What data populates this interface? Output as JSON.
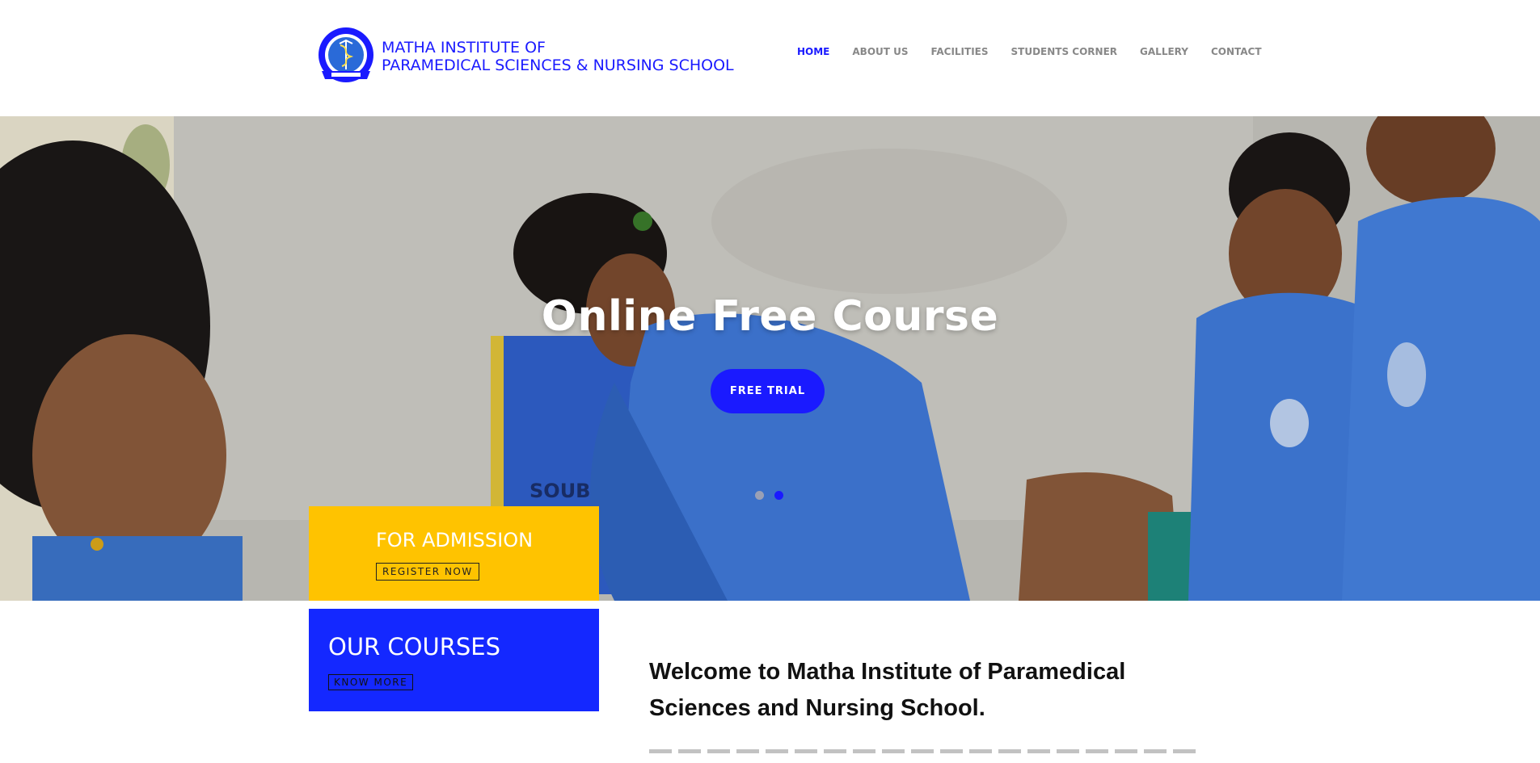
{
  "brand": {
    "line1": "MATHA INSTITUTE OF",
    "line2": "PARAMEDICAL SCIENCES & NURSING SCHOOL",
    "color": "#1a1aff"
  },
  "nav": {
    "items": [
      {
        "label": "HOME",
        "active": true
      },
      {
        "label": "ABOUT US",
        "active": false
      },
      {
        "label": "FACILITIES",
        "active": false
      },
      {
        "label": "STUDENTS CORNER",
        "active": false
      },
      {
        "label": "GALLERY",
        "active": false
      },
      {
        "label": "CONTACT",
        "active": false
      }
    ]
  },
  "hero": {
    "title": "Online Free Course",
    "button_label": "FREE TRIAL",
    "bag_text": "SOUBHAGYA",
    "slides": 2,
    "active_slide": 2
  },
  "admission": {
    "title": "FOR ADMISSION",
    "button_label": "REGISTER NOW",
    "color": "#ffc300"
  },
  "courses": {
    "title": "OUR COURSES",
    "button_label": "KNOW MORE",
    "color": "#1428ff"
  },
  "welcome": {
    "heading_line1": "Welcome to Matha Institute of Paramedical",
    "heading_line2": "Sciences and Nursing School."
  },
  "colors": {
    "accent": "#1a1aff",
    "uniform_blue": "#3b73c8",
    "nav_text": "#888888"
  }
}
